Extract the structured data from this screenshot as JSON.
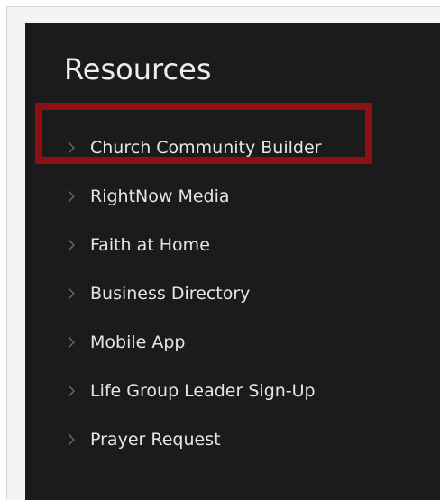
{
  "resources": {
    "title": "Resources",
    "items": [
      {
        "label": "Church Community Builder"
      },
      {
        "label": "RightNow Media"
      },
      {
        "label": "Faith at Home"
      },
      {
        "label": "Business Directory"
      },
      {
        "label": "Mobile App"
      },
      {
        "label": "Life Group Leader Sign-Up"
      },
      {
        "label": "Prayer Request"
      }
    ]
  },
  "highlight": {
    "target_item": "Church Community Builder",
    "color": "#8e1015"
  },
  "colors": {
    "panel_background": "#1b1b1b",
    "text": "#e6e6e6",
    "chevron": "#6f6f6f"
  }
}
